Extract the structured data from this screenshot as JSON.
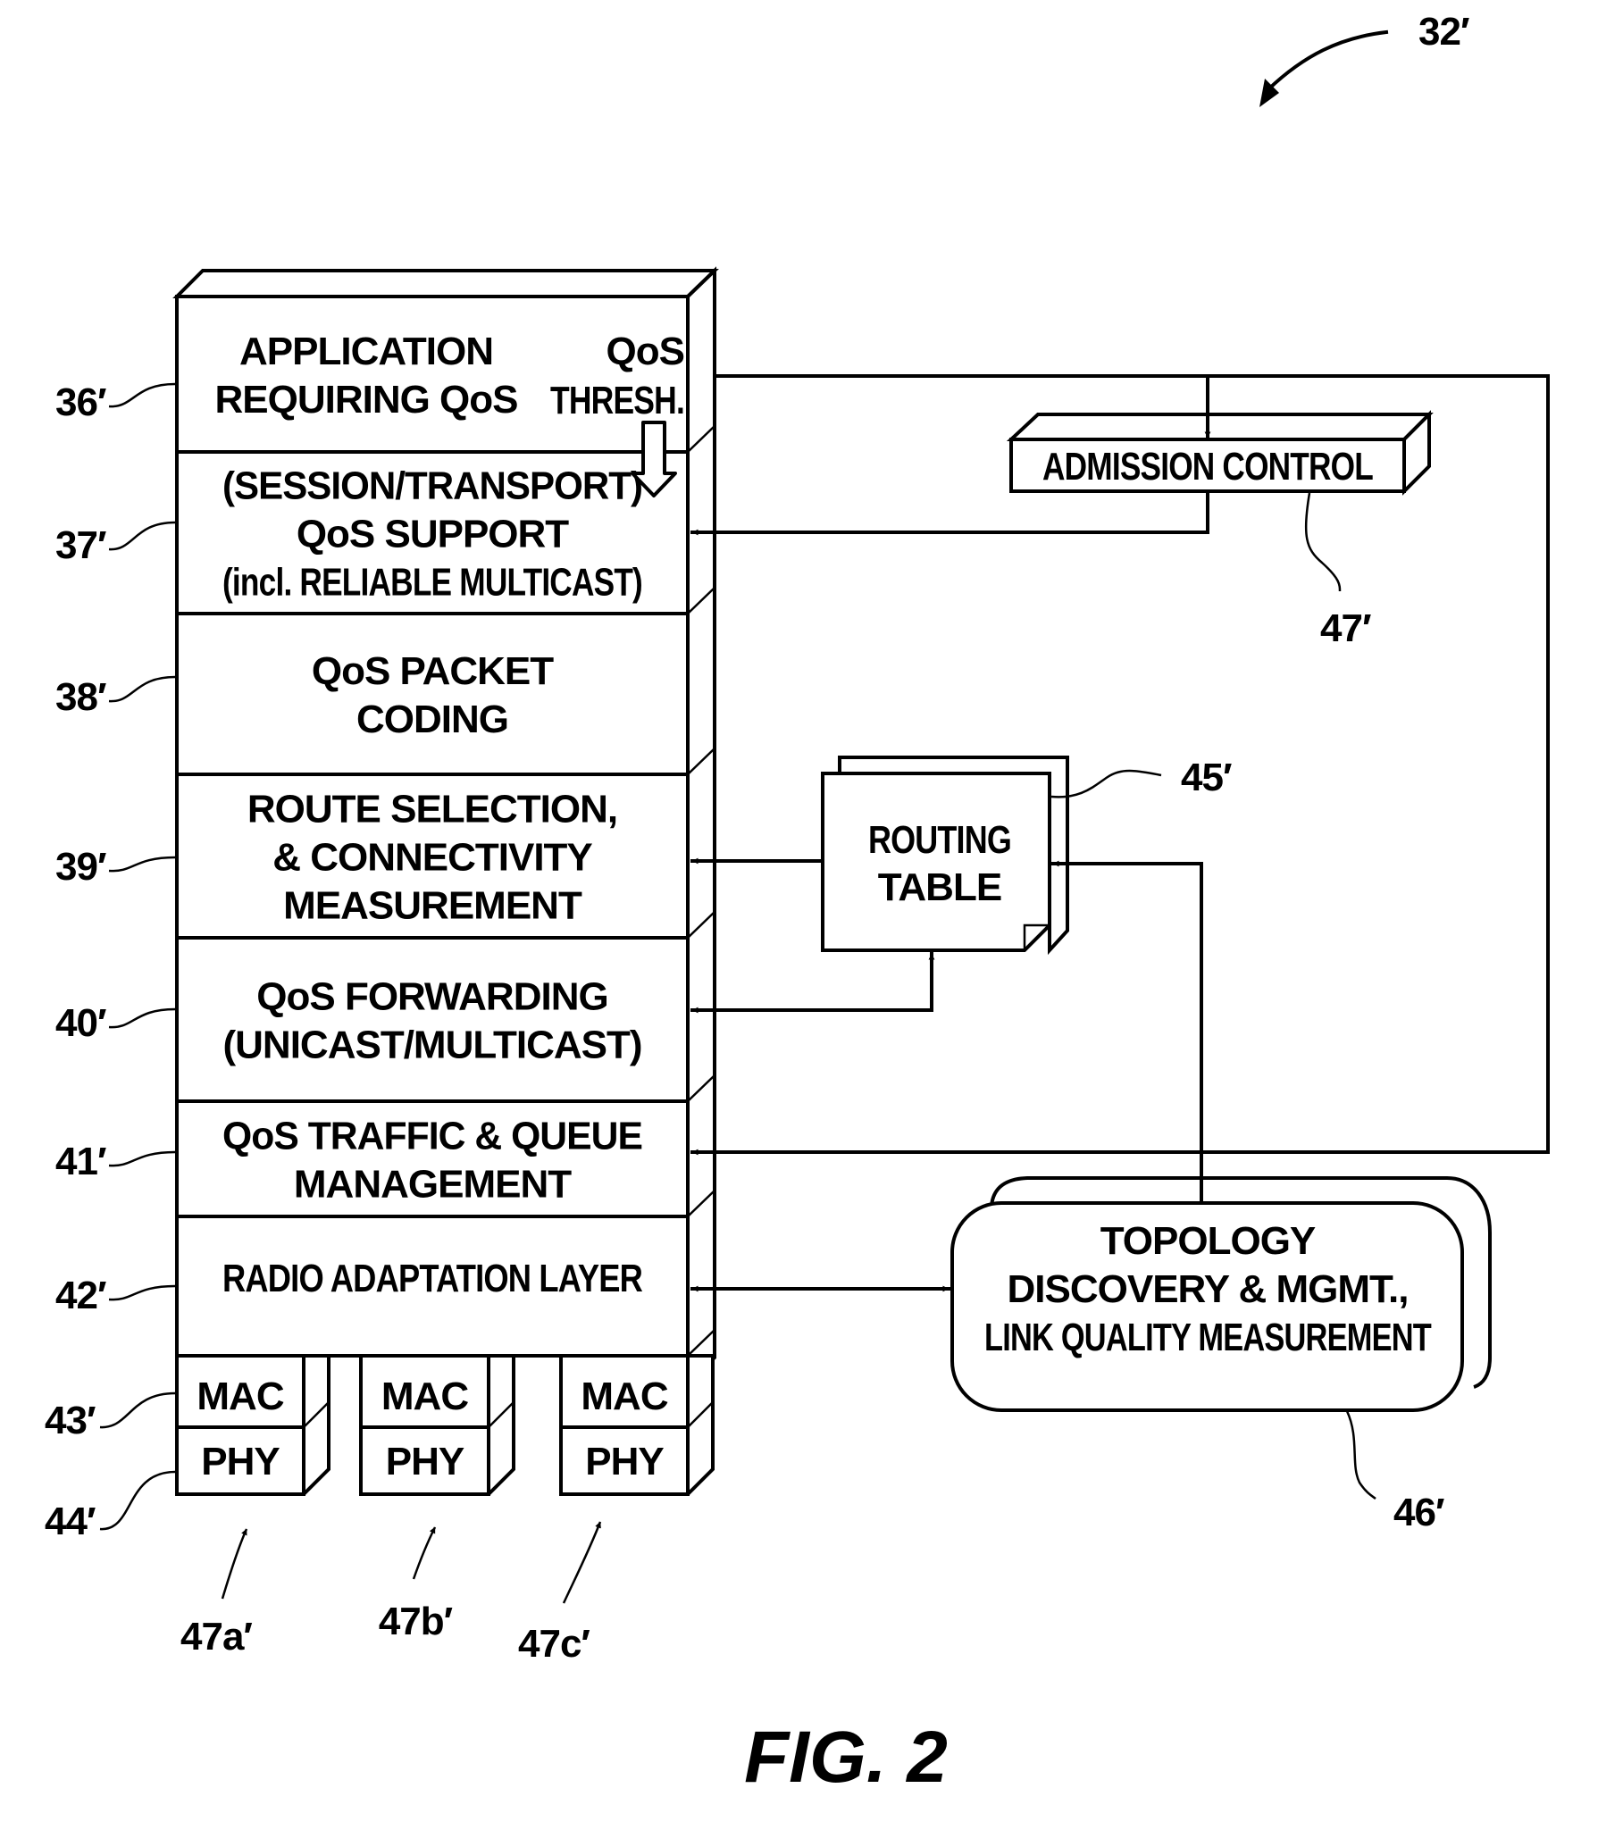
{
  "figure": {
    "title": "FIG. 2",
    "reference": "32′"
  },
  "stack": {
    "layers": [
      {
        "ref": "36′",
        "lines": [
          "APPLICATION",
          "REQUIRING QoS"
        ],
        "side_lines": [
          "QoS",
          "THRESH."
        ]
      },
      {
        "ref": "37′",
        "lines": [
          "(SESSION/TRANSPORT)",
          "QoS SUPPORT",
          "(incl. RELIABLE MULTICAST)"
        ]
      },
      {
        "ref": "38′",
        "lines": [
          "QoS PACKET",
          "CODING"
        ]
      },
      {
        "ref": "39′",
        "lines": [
          "ROUTE SELECTION,",
          "& CONNECTIVITY",
          "MEASUREMENT"
        ]
      },
      {
        "ref": "40′",
        "lines": [
          "QoS FORWARDING",
          "(UNICAST/MULTICAST)"
        ]
      },
      {
        "ref": "41′",
        "lines": [
          "QoS TRAFFIC & QUEUE",
          "MANAGEMENT"
        ]
      },
      {
        "ref": "42′",
        "lines": [
          "RADIO ADAPTATION LAYER"
        ]
      }
    ],
    "mac_ref": "43′",
    "phy_ref": "44′",
    "interfaces": [
      {
        "ref": "47a′",
        "mac": "MAC",
        "phy": "PHY"
      },
      {
        "ref": "47b′",
        "mac": "MAC",
        "phy": "PHY"
      },
      {
        "ref": "47c′",
        "mac": "MAC",
        "phy": "PHY"
      }
    ]
  },
  "admission_control": {
    "label": "ADMISSION CONTROL",
    "ref": "47′"
  },
  "routing_table": {
    "lines": [
      "ROUTING",
      "TABLE"
    ],
    "ref": "45′"
  },
  "topology": {
    "lines": [
      "TOPOLOGY",
      "DISCOVERY & MGMT.,",
      "LINK QUALITY MEASUREMENT"
    ],
    "ref": "46′"
  }
}
